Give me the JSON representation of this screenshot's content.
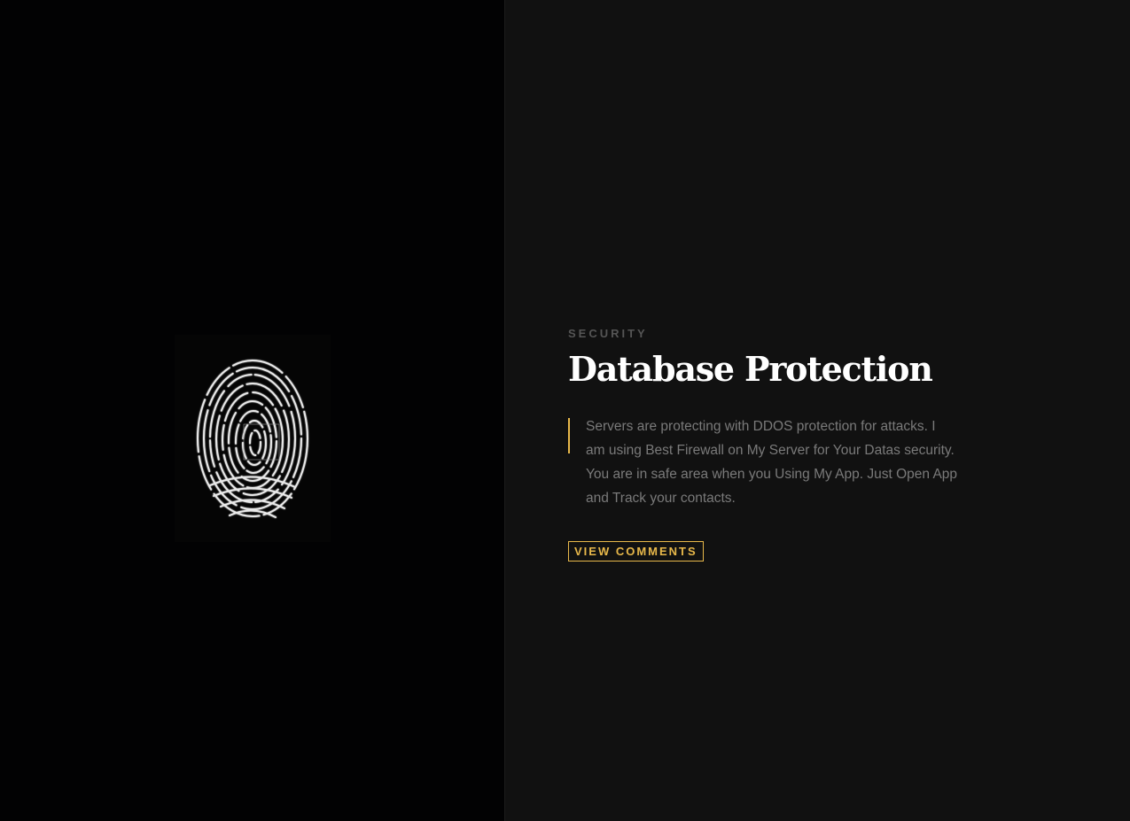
{
  "hero": {
    "image_icon": "fingerprint-icon",
    "eyebrow": "SECURITY",
    "title": "Database Protection",
    "description": "Servers are protecting with DDOS protection for attacks. I am using Best Firewall on My Server for Your Datas security. You are in safe area when you Using My App. Just Open App and Track your contacts.",
    "button_label": "VIEW COMMENTS"
  },
  "colors": {
    "accent": "#e8b84a",
    "left_background": "#020203",
    "right_background": "#111111",
    "title": "#ffffff",
    "body_text": "#7a7a7a",
    "eyebrow": "#555555"
  }
}
